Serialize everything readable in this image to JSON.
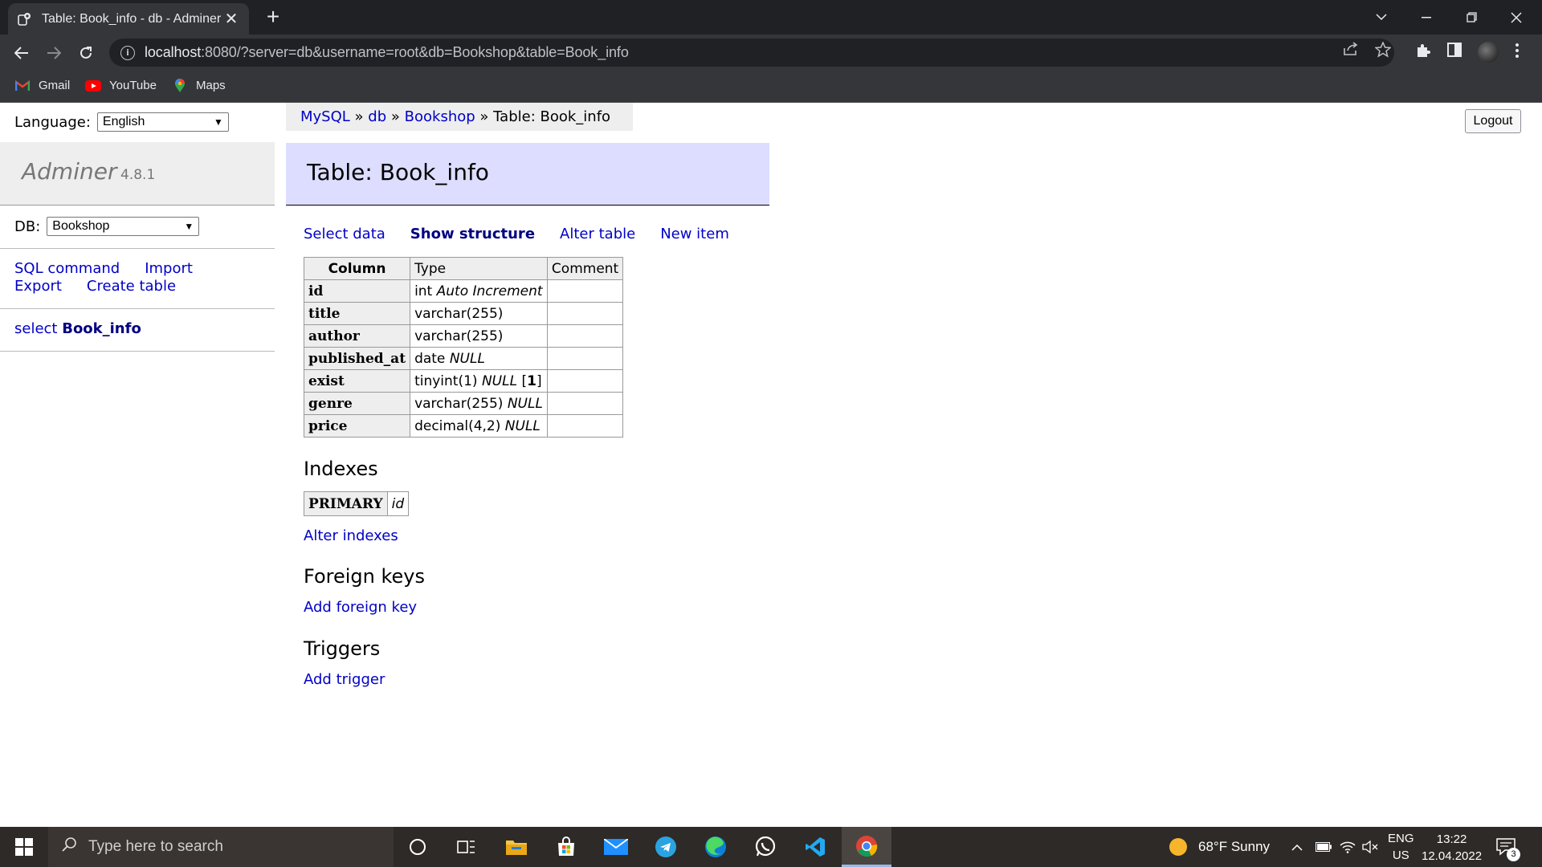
{
  "browser": {
    "tab_title": "Table: Book_info - db - Adminer",
    "tab_close": "✕",
    "new_tab": "+",
    "url_host": "localhost",
    "url_rest": ":8080/?server=db&username=root&db=Bookshop&table=Book_info",
    "bookmarks": [
      {
        "label": "Gmail",
        "icon": "gmail-icon",
        "color": "#ea4335"
      },
      {
        "label": "YouTube",
        "icon": "youtube-icon",
        "color": "#ff0000"
      },
      {
        "label": "Maps",
        "icon": "maps-icon",
        "color": "#34a853"
      }
    ]
  },
  "adminer": {
    "language_label": "Language:",
    "language_value": "English",
    "logo": "Adminer",
    "version": "4.8.1",
    "db_label": "DB:",
    "db_value": "Bookshop",
    "side_links": {
      "sql_command": "SQL command",
      "import": "Import",
      "export": "Export",
      "create_table": "Create table"
    },
    "table_link_prefix": "select",
    "table_link_name": "Book_info",
    "breadcrumb": {
      "mysql": "MySQL",
      "sep": "»",
      "db": "db",
      "database": "Bookshop",
      "current": "Table: Book_info"
    },
    "logout": "Logout",
    "heading": "Table: Book_info",
    "actions": {
      "select_data": "Select data",
      "show_structure": "Show structure",
      "alter_table": "Alter table",
      "new_item": "New item"
    },
    "columns_header": {
      "column": "Column",
      "type": "Type",
      "comment": "Comment"
    },
    "columns": [
      {
        "name": "id",
        "type": "int",
        "extra": "Auto Increment",
        "default": ""
      },
      {
        "name": "title",
        "type": "varchar(255)",
        "extra": "",
        "default": ""
      },
      {
        "name": "author",
        "type": "varchar(255)",
        "extra": "",
        "default": ""
      },
      {
        "name": "published_at",
        "type": "date",
        "extra": "NULL",
        "default": ""
      },
      {
        "name": "exist",
        "type": "tinyint(1)",
        "extra": "NULL",
        "default": "1"
      },
      {
        "name": "genre",
        "type": "varchar(255)",
        "extra": "NULL",
        "default": ""
      },
      {
        "name": "price",
        "type": "decimal(4,2)",
        "extra": "NULL",
        "default": ""
      }
    ],
    "indexes_title": "Indexes",
    "index": {
      "kind": "PRIMARY",
      "columns": "id"
    },
    "alter_indexes": "Alter indexes",
    "foreign_keys_title": "Foreign keys",
    "add_foreign_key": "Add foreign key",
    "triggers_title": "Triggers",
    "add_trigger": "Add trigger"
  },
  "taskbar": {
    "search_placeholder": "Type here to search",
    "weather": "68°F  Sunny",
    "lang_top": "ENG",
    "lang_bottom": "US",
    "time": "13:22",
    "date": "12.04.2022",
    "notifications": "3"
  }
}
